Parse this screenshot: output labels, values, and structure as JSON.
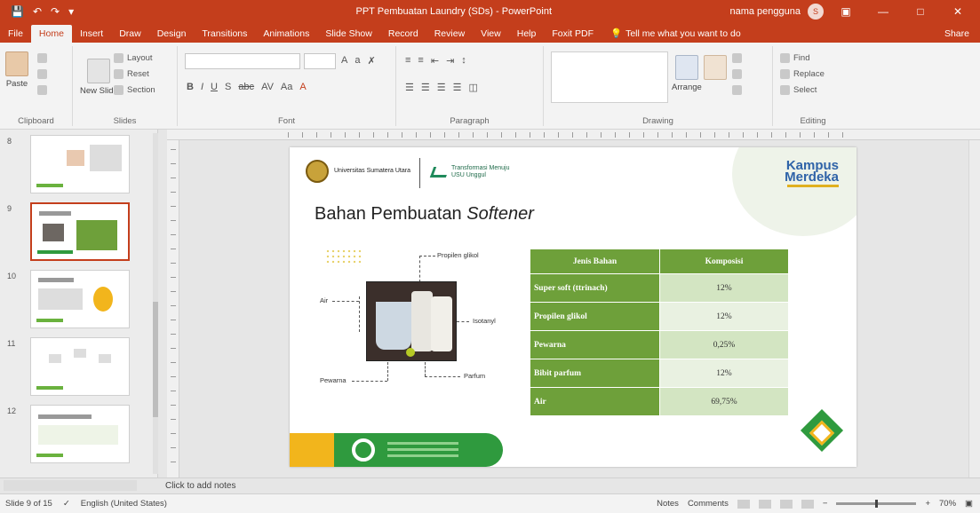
{
  "titlebar": {
    "save_icon": "save-icon",
    "undo_icon": "undo-icon",
    "redo_icon": "redo-icon",
    "doc_title": "PPT Pembuatan Laundry (SDs) - PowerPoint",
    "user_name": "nama pengguna",
    "avatar_initials": "S",
    "accent": "#c43e1c"
  },
  "tabs": [
    "File",
    "Home",
    "Insert",
    "Draw",
    "Design",
    "Transitions",
    "Animations",
    "Slide Show",
    "Record",
    "Review",
    "View",
    "Help",
    "Foxit PDF"
  ],
  "active_tab": "Home",
  "tellme": "Tell me what you want to do",
  "share": "Share",
  "ribbon": {
    "clipboard": {
      "label": "Clipboard",
      "paste": "Paste",
      "cut": "Cut",
      "copy": "Copy",
      "format_painter": "Format Painter"
    },
    "slides": {
      "label": "Slides",
      "new_slide": "New Slide",
      "layout": "Layout",
      "reset": "Reset",
      "section": "Section"
    },
    "font": {
      "label": "Font"
    },
    "paragraph": {
      "label": "Paragraph"
    },
    "drawing": {
      "label": "Drawing",
      "arrange": "Arrange",
      "quick_styles": "Quick Styles",
      "shape_fill": "Shape Fill",
      "shape_outline": "Shape Outline",
      "shape_effects": "Shape Effects"
    },
    "editing": {
      "label": "Editing",
      "find": "Find",
      "replace": "Replace",
      "select": "Select"
    }
  },
  "thumbnails": [
    {
      "num": "8",
      "active": false
    },
    {
      "num": "9",
      "active": true
    },
    {
      "num": "10",
      "active": false
    },
    {
      "num": "11",
      "active": false
    },
    {
      "num": "12",
      "active": false
    }
  ],
  "slide": {
    "logo1_text": "Universitas Sumatera Utara",
    "logo2_text": "Transformasi Menuju USU Unggul",
    "brand_line1": "Kampus",
    "brand_line2": "Merdeka",
    "title_plain": "Bahan Pembuatan ",
    "title_italic": "Softener",
    "diagram": {
      "label_top": "Propilen glikol",
      "label_left": "Air",
      "label_right": "Isotanyl",
      "label_bottom_left": "Pewarna",
      "label_bottom_right": "Parfum"
    },
    "table": {
      "headers": [
        "Jenis Bahan",
        "Komposisi"
      ],
      "rows": [
        {
          "name": "Super soft (ttrinach)",
          "value": "12%"
        },
        {
          "name": "Propilen glikol",
          "value": "12%"
        },
        {
          "name": "Pewarna",
          "value": "0,25%"
        },
        {
          "name": "Bibit parfum",
          "value": "12%"
        },
        {
          "name": "Air",
          "value": "69,75%"
        }
      ]
    },
    "accent_green": "#6ea03a",
    "accent_yellow": "#f2b51c"
  },
  "notes_placeholder": "Click to add notes",
  "status": {
    "slide_info": "Slide 9 of 15",
    "language": "English (United States)",
    "notes": "Notes",
    "comments": "Comments",
    "zoom": "70%"
  }
}
